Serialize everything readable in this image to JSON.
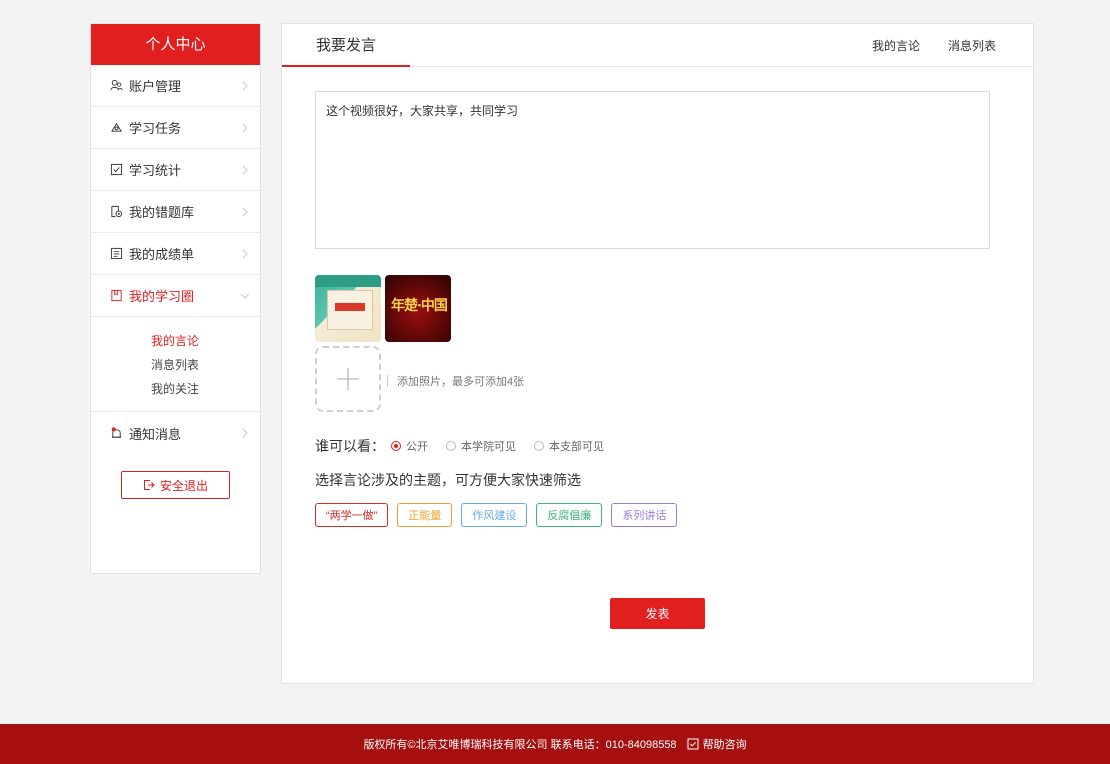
{
  "sidebar": {
    "title": "个人中心",
    "items": [
      {
        "label": "账户管理",
        "icon": "users-icon"
      },
      {
        "label": "学习任务",
        "icon": "task-icon"
      },
      {
        "label": "学习统计",
        "icon": "checkbox-icon"
      },
      {
        "label": "我的错题库",
        "icon": "wrong-questions-icon"
      },
      {
        "label": "我的成绩单",
        "icon": "report-icon"
      },
      {
        "label": "我的学习圈",
        "icon": "bookmark-icon",
        "expanded": true
      },
      {
        "label": "通知消息",
        "icon": "bell-icon"
      }
    ],
    "subitems": [
      "我的言论",
      "消息列表",
      "我的关注"
    ],
    "active_subitem": "我的言论",
    "logout_label": "安全退出"
  },
  "main": {
    "tab_title": "我要发言",
    "links": [
      "我的言论",
      "消息列表"
    ],
    "post_text": "这个视频很好，大家共享，共同学习",
    "thumb2_text": "年楚·中国",
    "add_photo_hint": "添加照片，最多可添加4张",
    "visibility": {
      "label": "谁可以看：",
      "options": [
        "公开",
        "本学院可见",
        "本支部可见"
      ],
      "selected": "公开"
    },
    "topic_title": "选择言论涉及的主题，可方便大家快速筛选",
    "tags": [
      {
        "label": "“两学一做”",
        "color": "#d02c2c"
      },
      {
        "label": "正能量",
        "color": "#f0a030"
      },
      {
        "label": "作风建设",
        "color": "#6aa8e8"
      },
      {
        "label": "反腐倡廉",
        "color": "#3cb878"
      },
      {
        "label": "系列讲话",
        "color": "#9a7ad8"
      }
    ],
    "publish_label": "发表"
  },
  "footer": {
    "copyright": "版权所有©北京艾唯博瑞科技有限公司 联系电话：010-84098558",
    "help_label": "帮助咨询"
  },
  "colors": {
    "accent": "#e21f1f",
    "footer": "#a50f0f"
  }
}
